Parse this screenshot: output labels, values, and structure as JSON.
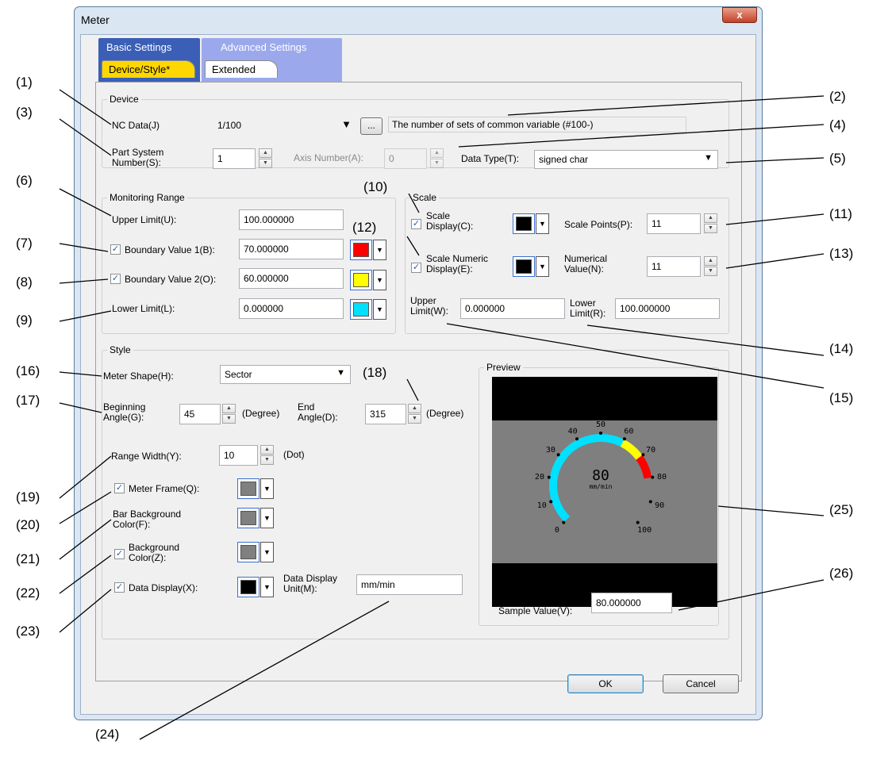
{
  "window": {
    "title": "Meter",
    "close_glyph": "x"
  },
  "tabs": {
    "basic": {
      "label": "Basic Settings",
      "sub": "Device/Style*"
    },
    "advanced": {
      "label": "Advanced Settings",
      "sub": "Extended"
    }
  },
  "device": {
    "title": "Device",
    "nc_data_label": "NC Data(J)",
    "nc_data_value": "1/100",
    "browse": "...",
    "description": "The number of sets of common variable (#100-)",
    "part_system_label": "Part System\nNumber(S):",
    "part_system_value": "1",
    "axis_number_label": "Axis Number(A):",
    "axis_number_value": "0",
    "data_type_label": "Data Type(T):",
    "data_type_value": "signed char"
  },
  "monitoring": {
    "title": "Monitoring Range",
    "upper_label": "Upper Limit(U):",
    "upper_value": "100.000000",
    "b1_label": "Boundary Value 1(B):",
    "b1_value": "70.000000",
    "b1_color": "#ff0000",
    "b2_label": "Boundary Value 2(O):",
    "b2_value": "60.000000",
    "b2_color": "#ffff00",
    "lower_label": "Lower Limit(L):",
    "lower_value": "0.000000",
    "lower_color": "#00e0ff"
  },
  "scale": {
    "title": "Scale",
    "display_label": "Scale\nDisplay(C):",
    "points_label": "Scale Points(P):",
    "points_value": "11",
    "numeric_label": "Scale Numeric\nDisplay(E):",
    "numerical_label": "Numerical\nValue(N):",
    "numerical_value": "11",
    "upper_label": "Upper\nLimit(W):",
    "upper_value": "0.000000",
    "lower_label": "Lower\nLimit(R):",
    "lower_value": "100.000000"
  },
  "style": {
    "title": "Style",
    "shape_label": "Meter Shape(H):",
    "shape_value": "Sector",
    "begin_label": "Beginning\nAngle(G):",
    "begin_value": "45",
    "end_label": "End\nAngle(D):",
    "end_value": "315",
    "degree": "(Degree)",
    "range_width_label": "Range Width(Y):",
    "range_width_value": "10",
    "dot": "(Dot)",
    "frame_label": "Meter Frame(Q):",
    "bar_bg_label": "Bar Background\nColor(F):",
    "bg_label": "Background\nColor(Z):",
    "data_display_label": "Data Display(X):",
    "unit_label": "Data Display\nUnit(M):",
    "unit_value": "mm/min"
  },
  "preview": {
    "title": "Preview",
    "sample_label": "Sample Value(V):",
    "sample_value": "80.000000",
    "value_text": "80",
    "unit_text": "mm/min",
    "ticks": [
      "0",
      "10",
      "20",
      "30",
      "40",
      "50",
      "60",
      "70",
      "80",
      "90",
      "100"
    ]
  },
  "buttons": {
    "ok": "OK",
    "cancel": "Cancel"
  },
  "callouts": [
    "(1)",
    "(2)",
    "(3)",
    "(4)",
    "(5)",
    "(6)",
    "(7)",
    "(8)",
    "(9)",
    "(10)",
    "(11)",
    "(12)",
    "(13)",
    "(14)",
    "(15)",
    "(16)",
    "(17)",
    "(18)",
    "(19)",
    "(20)",
    "(21)",
    "(22)",
    "(23)",
    "(24)",
    "(25)",
    "(26)"
  ],
  "colors": {
    "tab_blue": "#3b5fb6",
    "tab_light": "#9ba9ec",
    "active_tab": "#ffd700",
    "gray_swatch": "#808080"
  }
}
